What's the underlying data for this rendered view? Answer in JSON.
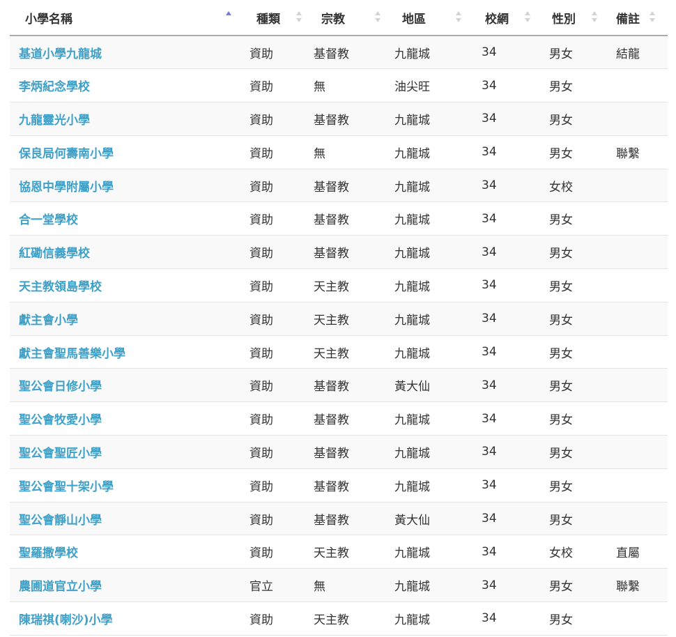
{
  "table": {
    "headers": [
      {
        "key": "name",
        "label": "小學名稱",
        "sort": "asc"
      },
      {
        "key": "type",
        "label": "種類",
        "sort": "none"
      },
      {
        "key": "religion",
        "label": "宗教",
        "sort": "none"
      },
      {
        "key": "district",
        "label": "地區",
        "sort": "none"
      },
      {
        "key": "net",
        "label": "校網",
        "sort": "none"
      },
      {
        "key": "gender",
        "label": "性別",
        "sort": "none"
      },
      {
        "key": "remarks",
        "label": "備註",
        "sort": "none"
      }
    ],
    "rows": [
      {
        "name": "基道小學九龍城",
        "type": "資助",
        "religion": "基督教",
        "district": "九龍城",
        "net": "34",
        "gender": "男女",
        "remarks": "結龍"
      },
      {
        "name": "李炳紀念學校",
        "type": "資助",
        "religion": "無",
        "district": "油尖旺",
        "net": "34",
        "gender": "男女",
        "remarks": ""
      },
      {
        "name": "九龍靈光小學",
        "type": "資助",
        "religion": "基督教",
        "district": "九龍城",
        "net": "34",
        "gender": "男女",
        "remarks": ""
      },
      {
        "name": "保良局何壽南小學",
        "type": "資助",
        "religion": "無",
        "district": "九龍城",
        "net": "34",
        "gender": "男女",
        "remarks": "聯繫"
      },
      {
        "name": "協恩中學附屬小學",
        "type": "資助",
        "religion": "基督教",
        "district": "九龍城",
        "net": "34",
        "gender": "女校",
        "remarks": ""
      },
      {
        "name": "合一堂學校",
        "type": "資助",
        "religion": "基督教",
        "district": "九龍城",
        "net": "34",
        "gender": "男女",
        "remarks": ""
      },
      {
        "name": "紅磡信義學校",
        "type": "資助",
        "religion": "基督教",
        "district": "九龍城",
        "net": "34",
        "gender": "男女",
        "remarks": ""
      },
      {
        "name": "天主教領島學校",
        "type": "資助",
        "religion": "天主教",
        "district": "九龍城",
        "net": "34",
        "gender": "男女",
        "remarks": ""
      },
      {
        "name": "獻主會小學",
        "type": "資助",
        "religion": "天主教",
        "district": "九龍城",
        "net": "34",
        "gender": "男女",
        "remarks": ""
      },
      {
        "name": "獻主會聖馬善樂小學",
        "type": "資助",
        "religion": "天主教",
        "district": "九龍城",
        "net": "34",
        "gender": "男女",
        "remarks": ""
      },
      {
        "name": "聖公會日修小學",
        "type": "資助",
        "religion": "基督教",
        "district": "黃大仙",
        "net": "34",
        "gender": "男女",
        "remarks": ""
      },
      {
        "name": "聖公會牧愛小學",
        "type": "資助",
        "religion": "基督教",
        "district": "九龍城",
        "net": "34",
        "gender": "男女",
        "remarks": ""
      },
      {
        "name": "聖公會聖匠小學",
        "type": "資助",
        "religion": "基督教",
        "district": "九龍城",
        "net": "34",
        "gender": "男女",
        "remarks": ""
      },
      {
        "name": "聖公會聖十架小學",
        "type": "資助",
        "religion": "基督教",
        "district": "九龍城",
        "net": "34",
        "gender": "男女",
        "remarks": ""
      },
      {
        "name": "聖公會靜山小學",
        "type": "資助",
        "religion": "基督教",
        "district": "黃大仙",
        "net": "34",
        "gender": "男女",
        "remarks": ""
      },
      {
        "name": "聖羅撒學校",
        "type": "資助",
        "religion": "天主教",
        "district": "九龍城",
        "net": "34",
        "gender": "女校",
        "remarks": "直屬"
      },
      {
        "name": "農圃道官立小學",
        "type": "官立",
        "religion": "無",
        "district": "九龍城",
        "net": "34",
        "gender": "男女",
        "remarks": "聯繫"
      },
      {
        "name": "陳瑞祺(喇沙)小學",
        "type": "資助",
        "religion": "天主教",
        "district": "九龍城",
        "net": "34",
        "gender": "男女",
        "remarks": ""
      }
    ]
  },
  "colors": {
    "link": "#3fa0c8",
    "sort_active": "#7b7bd8",
    "sort_inactive": "#d4d4d4",
    "row_stripe": "#f9f9f9",
    "header_border": "#aaaaaa"
  },
  "icons": {
    "sort_asc": "sort-asc-icon",
    "sort_both": "sort-both-icon"
  }
}
